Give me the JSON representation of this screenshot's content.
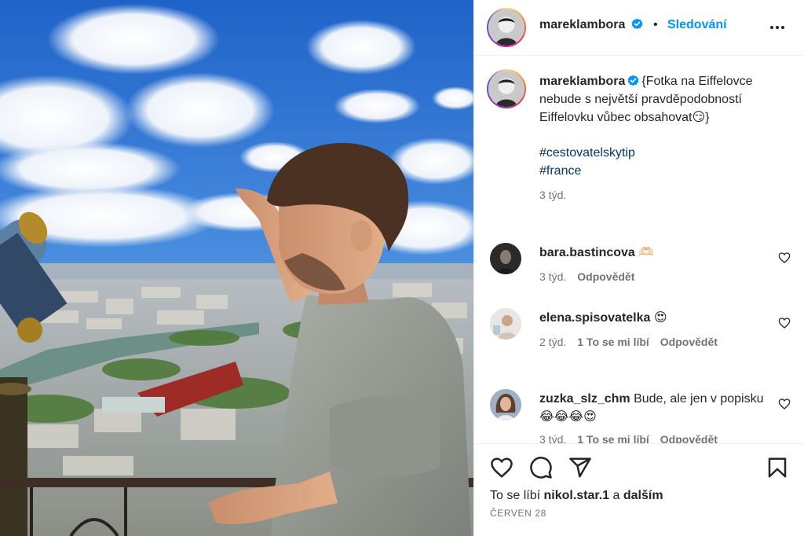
{
  "post": {
    "author": "mareklambora",
    "separator": "•",
    "follow_label": "Sledování",
    "more_icon": "more-horizontal-icon",
    "verified_icon": "verified-badge-icon",
    "caption_text": "{Fotka na Eiffelovce nebude s největší pravděpodobností Eiffelovku vůbec obsahovat😏}",
    "hashtags": [
      "#cestovatelskytip",
      "#france"
    ],
    "caption_time": "3 týd.",
    "photo_description_icon": "post-photo"
  },
  "comments": [
    {
      "user": "bara.bastincova",
      "text": "🫶🏻",
      "time": "3 týd.",
      "likes": "",
      "reply": "Odpovědět"
    },
    {
      "user": "elena.spisovatelka",
      "text": "😍",
      "time": "2 týd.",
      "likes": "1 To se mi líbí",
      "reply": "Odpovědět"
    },
    {
      "user": "zuzka_slz_chm",
      "text": "Bude, ale jen v popisku 😂😂😂😍",
      "time": "3 týd.",
      "likes": "1 To se mi líbí",
      "reply": "Odpovědět"
    }
  ],
  "actions": {
    "like_icon": "heart-icon",
    "comment_icon": "comment-icon",
    "share_icon": "share-icon",
    "save_icon": "bookmark-icon"
  },
  "likes": {
    "prefix": "To se líbí ",
    "user": "nikol.star.1",
    "middle": " a ",
    "others": "dalším"
  },
  "date": "ČERVEN 28",
  "colors": {
    "link_blue": "#0095f6",
    "hashtag": "#00376b",
    "verified": "#0095f6",
    "muted": "#737373",
    "text": "#262626"
  }
}
